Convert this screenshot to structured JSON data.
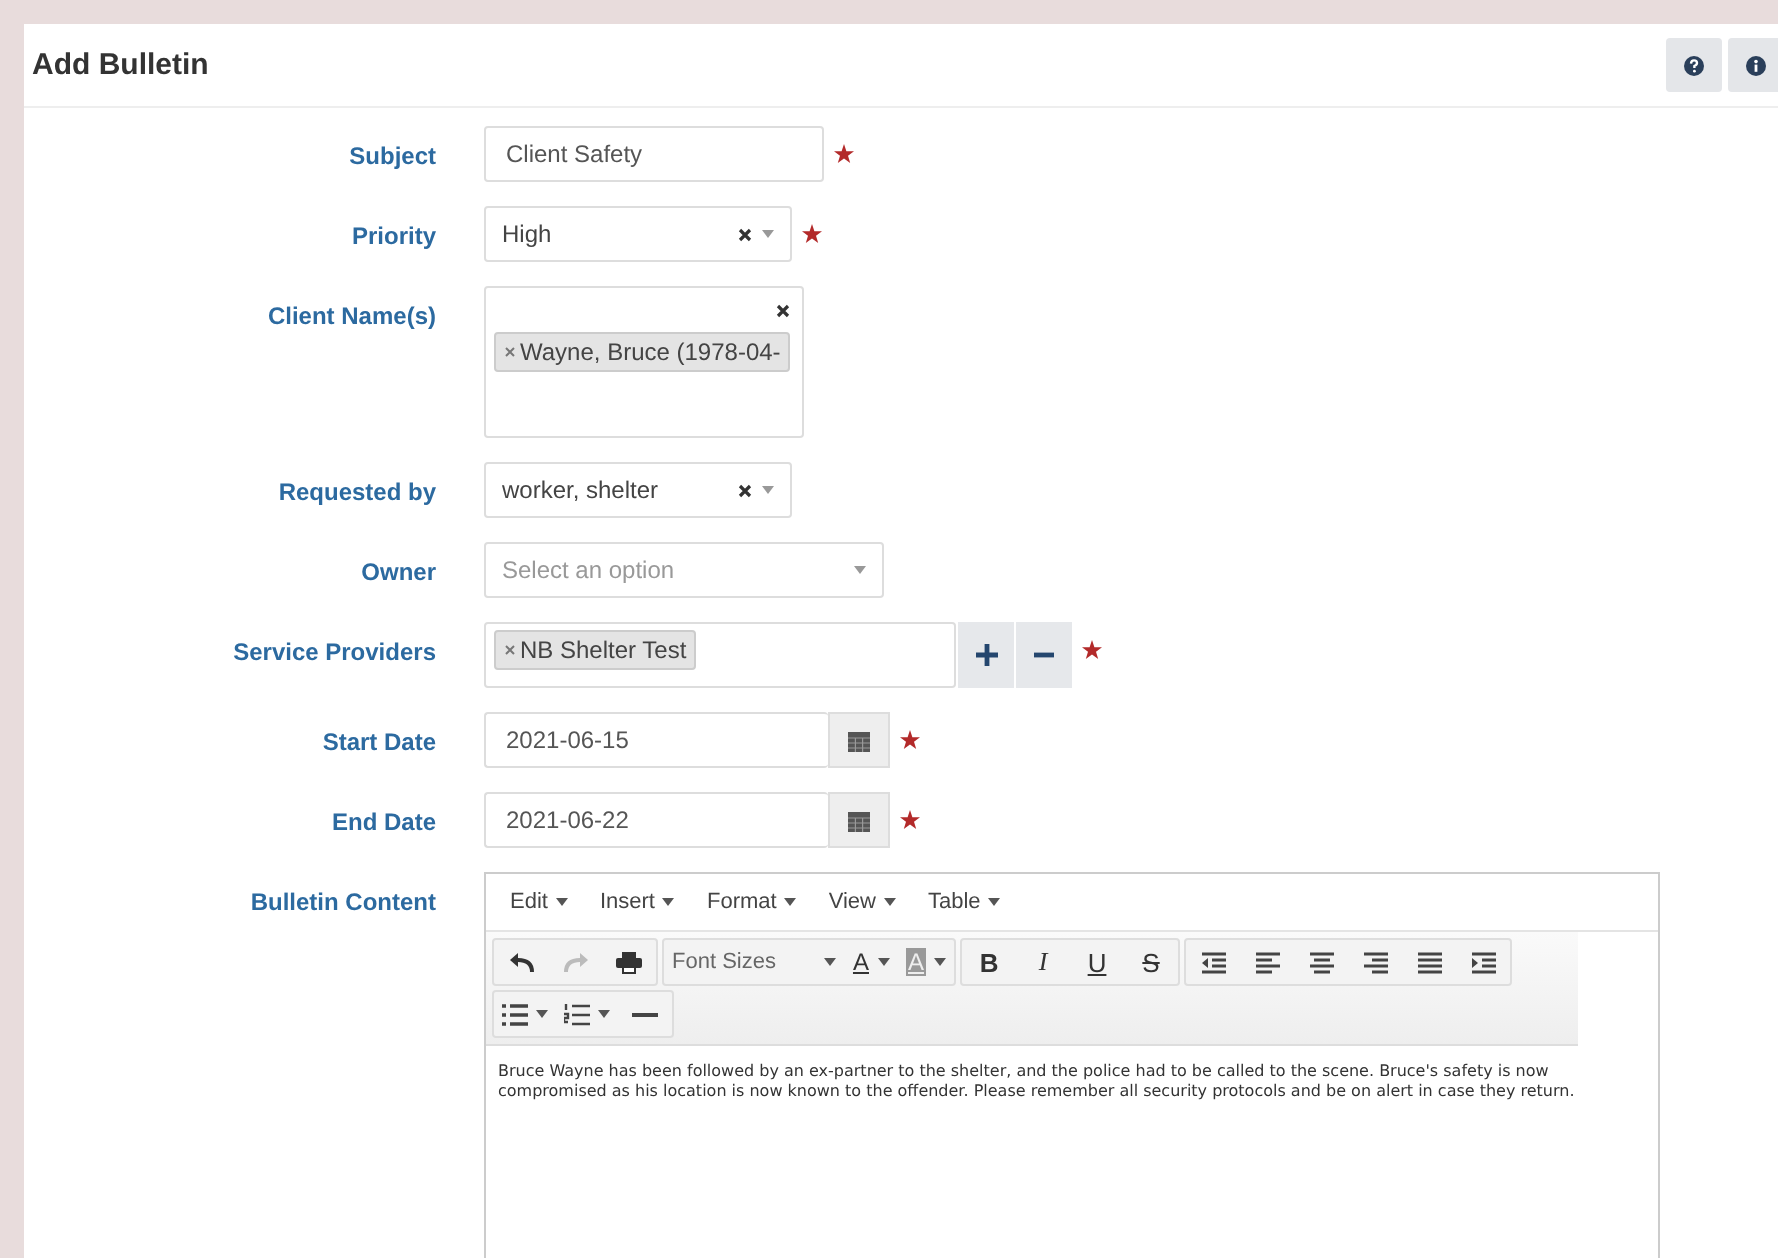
{
  "page": {
    "title": "Add Bulletin"
  },
  "fields": [
    {
      "kind": "text",
      "label": "Subject",
      "value": "Client Safety",
      "required": true
    },
    {
      "kind": "select",
      "label": "Priority",
      "value": "High",
      "clearable": true,
      "required": true
    },
    {
      "kind": "multiselect",
      "label": "Client Name(s)",
      "tags": [
        "Wayne, Bruce (1978-04-"
      ],
      "required": false
    },
    {
      "kind": "select",
      "label": "Requested by",
      "value": "worker, shelter",
      "clearable": true,
      "required": false
    },
    {
      "kind": "select",
      "label": "Owner",
      "placeholder": "Select an option",
      "clearable": false,
      "required": false
    },
    {
      "kind": "providers",
      "label": "Service Providers",
      "tags": [
        "NB Shelter Test"
      ],
      "required": true
    },
    {
      "kind": "date",
      "label": "Start Date",
      "value": "2021-06-15",
      "required": true
    },
    {
      "kind": "date",
      "label": "End Date",
      "value": "2021-06-22",
      "required": true
    },
    {
      "kind": "editor",
      "label": "Bulletin Content",
      "required": false,
      "menus": [
        "Edit",
        "Insert",
        "Format",
        "View",
        "Table"
      ],
      "history": [
        {
          "disabled": false
        },
        {
          "disabled": true
        }
      ],
      "font_sizes": "Font Sizes",
      "color_buttons": [
        "A",
        "A"
      ],
      "style_buttons": [
        "B",
        "I",
        "U",
        "S"
      ],
      "content": "Bruce Wayne has been followed by an ex-partner to the shelter, and the police had to be called to the scene. Bruce's safety is now compromised as his location is now known to the offender. Please remember all security protocols and be on alert in case they return."
    }
  ]
}
